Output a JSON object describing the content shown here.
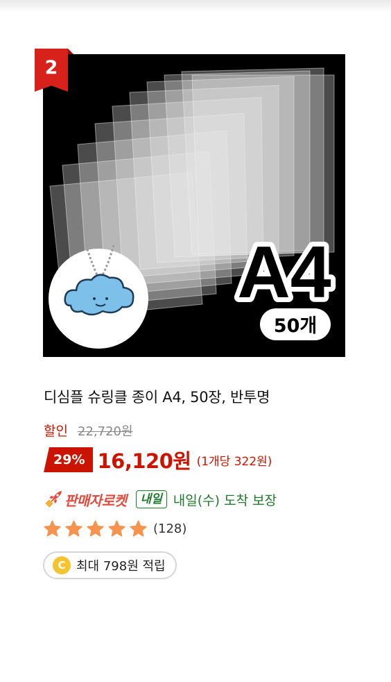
{
  "product": {
    "rank": "2",
    "image": {
      "badge_big": "A4",
      "badge_small": "50개",
      "description_icon": "cloud-keychain"
    },
    "title": "디심플 슈링클 종이 A4, 50장, 반투명",
    "discount_label": "할인",
    "original_price": "22,720원",
    "discount_percent": "29%",
    "sale_price": "16,120원",
    "unit_price": "(1개당 322원)",
    "delivery": {
      "rocket_label": "판매자로켓",
      "tomorrow_badge": "내일",
      "arrival_text": "내일(수) 도착 보장"
    },
    "rating": {
      "stars": 5,
      "max_stars": 5,
      "review_count": "(128)"
    },
    "reward": {
      "coin_letter": "C",
      "text": "최대 798원 적립"
    }
  },
  "colors": {
    "accent_red": "#cb1400",
    "rank_red": "#d8211b",
    "rocket_red": "#e5493c",
    "delivery_green": "#1f7a2c",
    "star_orange": "#f5934f",
    "coin_yellow": "#f4c430"
  }
}
